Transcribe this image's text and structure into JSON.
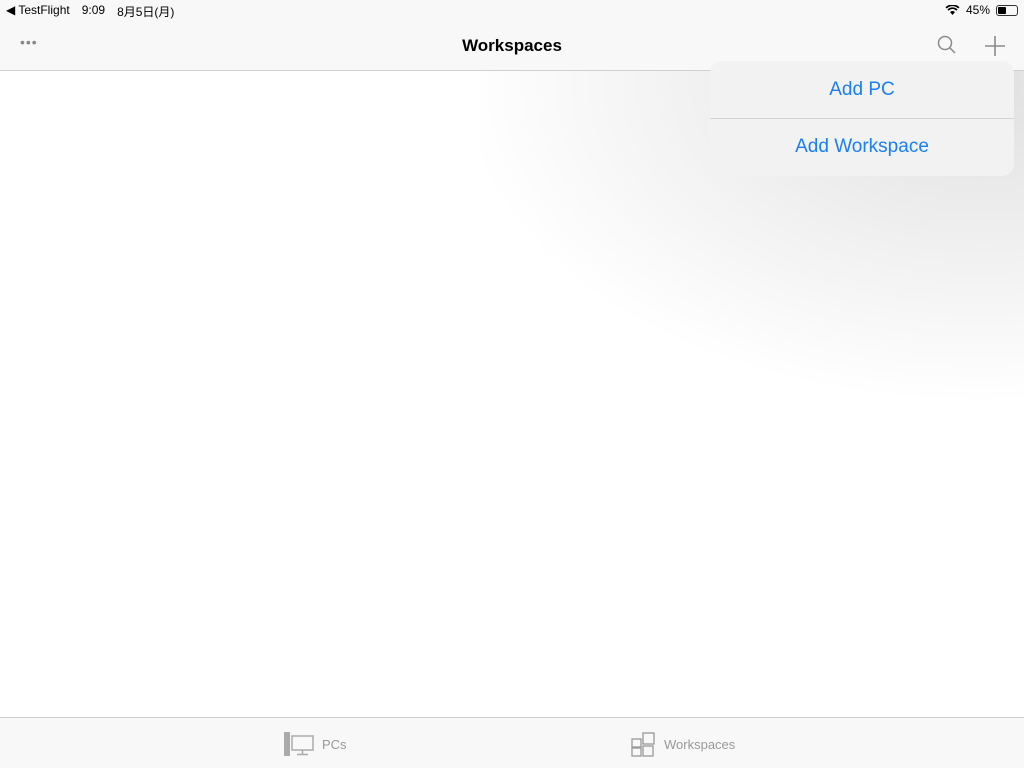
{
  "status": {
    "back": "◀ TestFlight",
    "time": "9:09",
    "date": "8月5日(月)",
    "battery": "45%",
    "battery_level": 0.45
  },
  "nav": {
    "title": "Workspaces",
    "more": "•••"
  },
  "menu": {
    "items": [
      "Add PC",
      "Add Workspace"
    ]
  },
  "tabs": [
    {
      "label": "PCs"
    },
    {
      "label": "Workspaces"
    }
  ],
  "colors": {
    "accent": "#1a7ff0",
    "inactive": "#999999"
  }
}
